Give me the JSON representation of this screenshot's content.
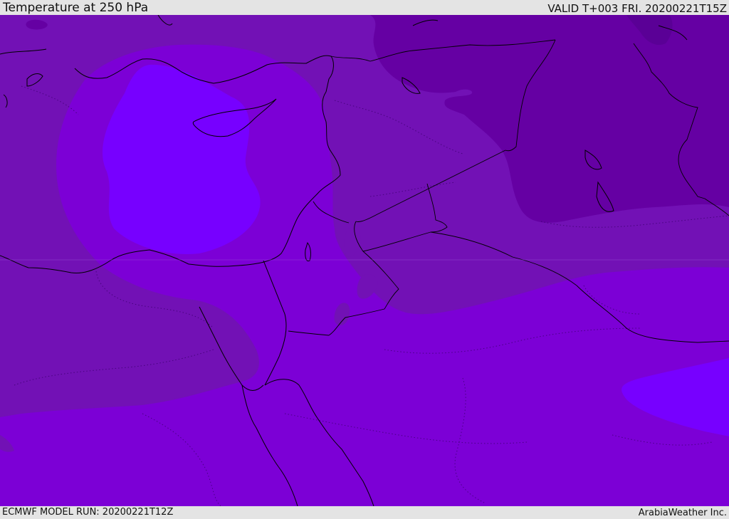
{
  "header": {
    "title": "Temperature at 250 hPa",
    "valid": "VALID T+003 FRI. 20200221T15Z"
  },
  "footer": {
    "model_run": "ECMWF MODEL RUN: 20200221T12Z",
    "credit": "ArabiaWeather Inc."
  },
  "colors": {
    "cold_dark": "#6500a3",
    "cold_mid": "#7211b5",
    "base": "#7c00d6",
    "warm": "#7700ff",
    "coast": "#000000",
    "background": "#e4e4e4"
  }
}
